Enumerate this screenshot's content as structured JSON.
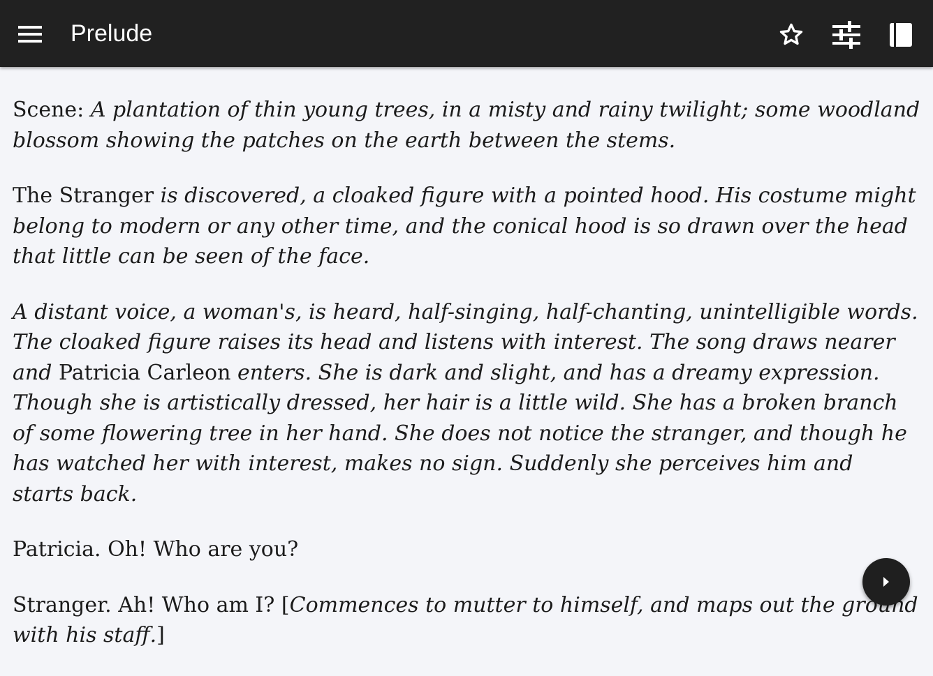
{
  "appbar": {
    "title": "Prelude",
    "icons": [
      "menu-icon",
      "star-outline-icon",
      "tune-icon",
      "book-icon"
    ]
  },
  "colors": {
    "appbar_bg": "#212121",
    "page_bg": "#f4f5f9",
    "text": "#1b1b1b",
    "fab_bg": "#1f1f1f"
  },
  "content": {
    "p1": {
      "label": "Scene: ",
      "text": "A plantation of thin young trees, in a misty and rainy twilight; some woodland blossom showing the patches on the earth between the stems."
    },
    "p2": {
      "name": "The Stranger",
      "text": " is discovered, a cloaked figure with a pointed hood. His costume might belong to modern or any other time, and the conical hood is so drawn over the head that little can be seen of the face."
    },
    "p3": {
      "text_a": "A distant voice, a woman's, is heard, half-singing, half-chanting, unintelligible words. The cloaked figure raises its head and listens with interest. The song draws nearer and ",
      "name": "Patricia Carleon",
      "text_b": " enters. She is dark and slight, and has a dreamy expression. Though she is artistically dressed, her hair is a little wild. She has a broken branch of some flowering tree in her hand. She does not notice the stranger, and though he has watched her with interest, makes no sign. Suddenly she perceives him and starts back."
    },
    "p4": {
      "text": "Patricia. Oh! Who are you?"
    },
    "p5": {
      "text_a": "Stranger. Ah! Who am I? [",
      "direction": "Commences to mutter to himself, and maps out the ground with his staff.",
      "text_b": "]"
    }
  },
  "fab": {
    "icon": "chevron-right-icon"
  }
}
